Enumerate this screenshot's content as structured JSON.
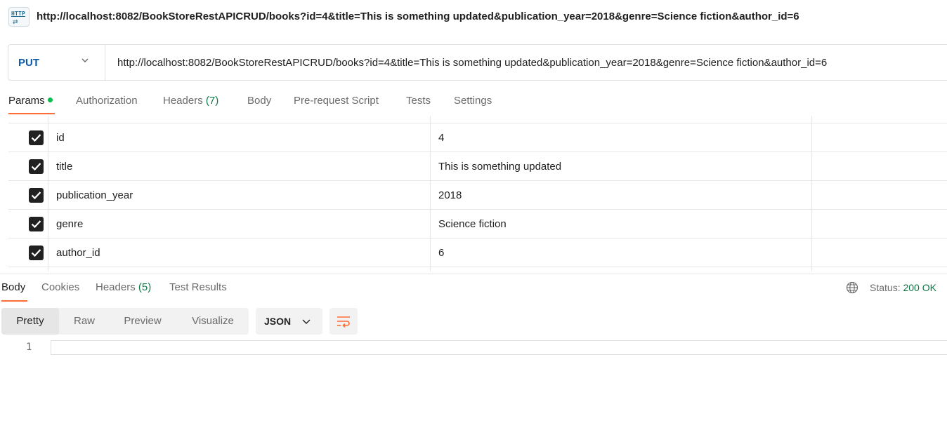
{
  "header": {
    "icon": "http-file-icon",
    "icon_label": "HTTP",
    "request_name": "http://localhost:8082/BookStoreRestAPICRUD/books?id=4&title=This is something updated&publication_year=2018&genre=Science fiction&author_id=6"
  },
  "request": {
    "method": "PUT",
    "url": "http://localhost:8082/BookStoreRestAPICRUD/books?id=4&title=This is something updated&publication_year=2018&genre=Science fiction&author_id=6"
  },
  "request_tabs": [
    {
      "label": "Params",
      "count": ""
    },
    {
      "label": "Authorization",
      "count": ""
    },
    {
      "label": "Headers",
      "count": "(7)"
    },
    {
      "label": "Body",
      "count": ""
    },
    {
      "label": "Pre-request Script",
      "count": ""
    },
    {
      "label": "Tests",
      "count": ""
    },
    {
      "label": "Settings",
      "count": ""
    }
  ],
  "params": [
    {
      "key": "id",
      "value": "4",
      "checked": true
    },
    {
      "key": "title",
      "value": "This is something updated",
      "checked": true
    },
    {
      "key": "publication_year",
      "value": "2018",
      "checked": true
    },
    {
      "key": "genre",
      "value": "Science fiction",
      "checked": true
    },
    {
      "key": "author_id",
      "value": "6",
      "checked": true
    }
  ],
  "response_tabs": [
    {
      "label": "Body",
      "count": ""
    },
    {
      "label": "Cookies",
      "count": ""
    },
    {
      "label": "Headers",
      "count": "(5)"
    },
    {
      "label": "Test Results",
      "count": ""
    }
  ],
  "response_status": {
    "label": "Status:",
    "value": "200 OK"
  },
  "view_modes": [
    "Pretty",
    "Raw",
    "Preview",
    "Visualize"
  ],
  "format": "JSON",
  "editor": {
    "line_number": "1"
  },
  "colors": {
    "accent": "#ff6c37",
    "method": "#0b5cad",
    "success": "#0a7a45",
    "dot": "#0cbb52"
  }
}
